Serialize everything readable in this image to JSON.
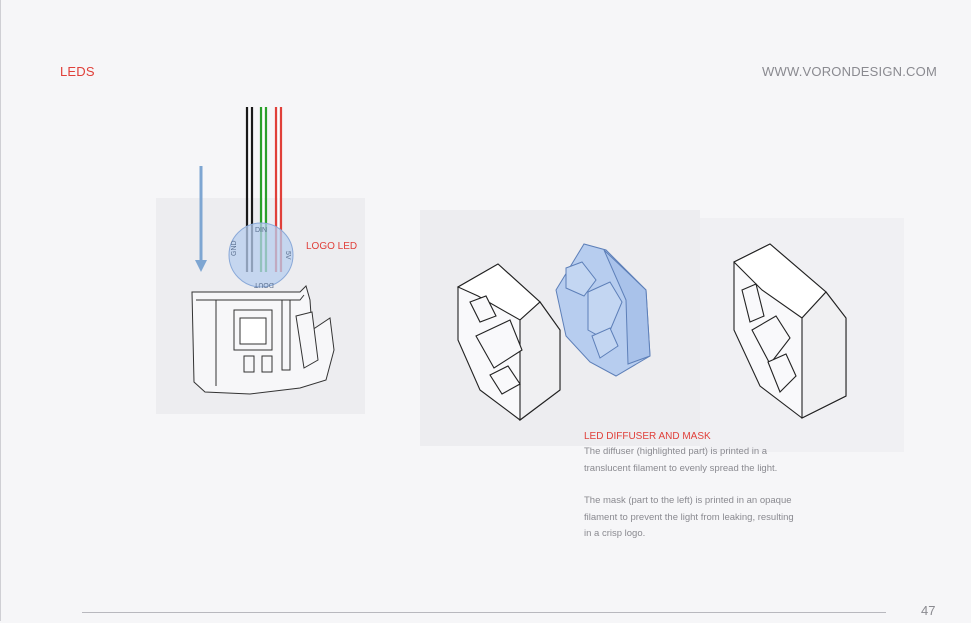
{
  "header": {
    "section_title": "LEDS",
    "site_url": "WWW.VORONDESIGN.COM"
  },
  "figure_left": {
    "callout": "LOGO LED",
    "pin_labels": [
      "GND",
      "DIN",
      "DOUT",
      "5V"
    ],
    "wire_colors": [
      "#1a1a1a",
      "#2aa02a",
      "#e0403a"
    ],
    "arrow_color": "#7ea6d2",
    "highlight_color": "#b7cdef"
  },
  "caption": {
    "title": "LED DIFFUSER AND MASK",
    "paragraph_1": "The diffuser (highlighted part) is printed in a\ntranslucent filament to evenly spread the light.",
    "paragraph_2": "The mask (part to the left) is printed in an opaque\nfilament to prevent the light from leaking, resulting\nin a crisp logo."
  },
  "footer": {
    "page_number": "47"
  }
}
